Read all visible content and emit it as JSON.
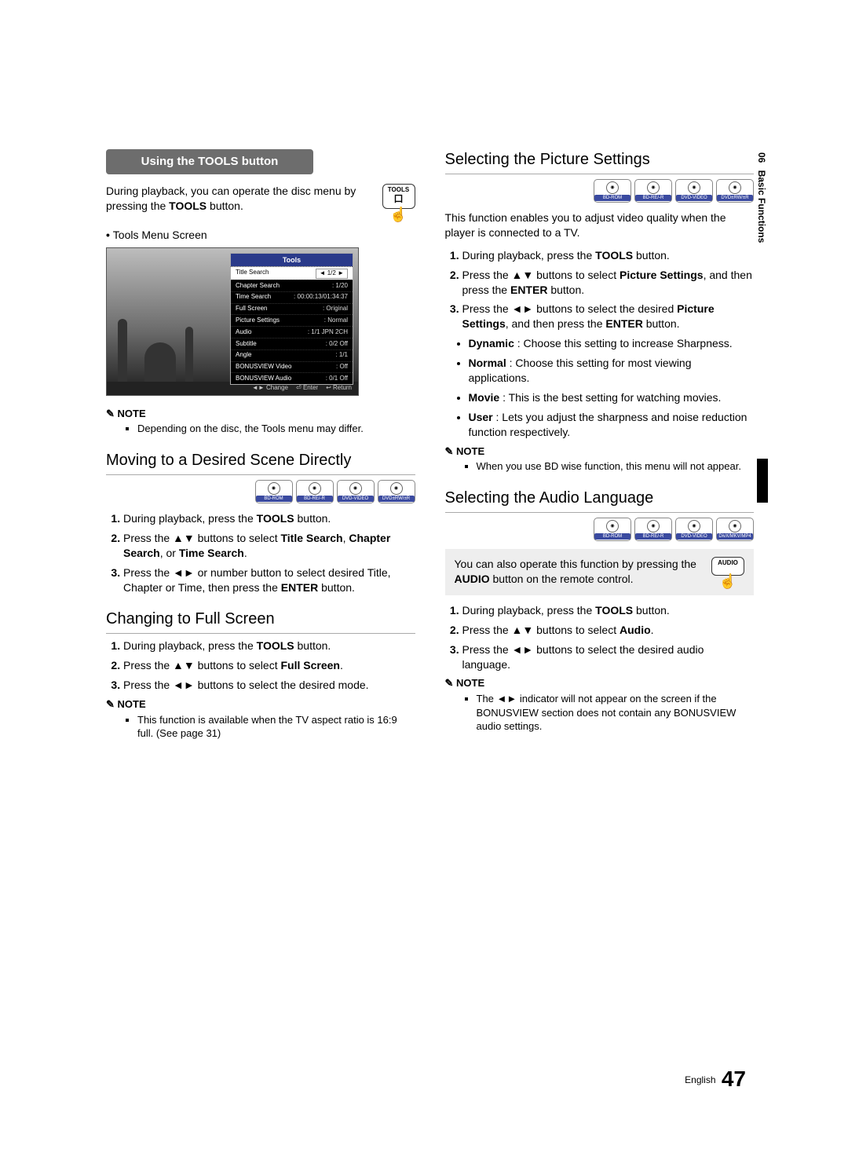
{
  "sideTab": {
    "num": "06",
    "label": "Basic Functions"
  },
  "footer": {
    "lang": "English",
    "page": "47"
  },
  "left": {
    "sectionTab": "Using the TOOLS button",
    "introA": "During playback, you can operate the disc menu by pressing the ",
    "introBold": "TOOLS",
    "introB": " button.",
    "toolsBtn": {
      "label": "TOOLS",
      "sub": "口"
    },
    "toolsMenuLabel": "Tools Menu Screen",
    "toolsPanel": {
      "title": "Tools",
      "rows": [
        {
          "k": "Title Search",
          "v": "1/2",
          "hi": true,
          "arrows": true
        },
        {
          "k": "Chapter Search",
          "v": "1/20"
        },
        {
          "k": "Time Search",
          "v": "00:00:13/01:34:37"
        },
        {
          "k": "Full Screen",
          "v": "Original"
        },
        {
          "k": "Picture Settings",
          "v": "Normal"
        },
        {
          "k": "Audio",
          "v": "1/1 JPN 2CH"
        },
        {
          "k": "Subtitle",
          "v": "0/2 Off"
        },
        {
          "k": "Angle",
          "v": "1/1"
        },
        {
          "k": "BONUSVIEW Video",
          "v": "Off"
        },
        {
          "k": "BONUSVIEW Audio",
          "v": "0/1 Off"
        }
      ],
      "footer": [
        "◄► Change",
        "⏎ Enter",
        "↩ Return"
      ]
    },
    "note1Head": "NOTE",
    "note1Items": [
      "Depending on the disc, the Tools menu may differ."
    ],
    "h2a": "Moving to a Desired Scene Directly",
    "discRowA": [
      "BD-ROM",
      "BD-RE/-R",
      "DVD-VIDEO",
      "DVD±RW/±R"
    ],
    "stepsA": [
      {
        "pre": "During playback, press the ",
        "b": "TOOLS",
        "post": " button."
      },
      {
        "pre": "Press the ▲▼ buttons to select ",
        "b": "Title Search",
        "post2": ", ",
        "b2": "Chapter Search",
        "post3": ", or ",
        "b3": "Time Search",
        "post4": "."
      },
      {
        "pre": "Press the ◄► or number button to select desired Title, Chapter or Time, then press the ",
        "b": "ENTER",
        "post": " button."
      }
    ],
    "h2b": "Changing to Full Screen",
    "stepsB": [
      {
        "pre": "During playback, press the ",
        "b": "TOOLS",
        "post": " button."
      },
      {
        "pre": "Press the ▲▼ buttons to select ",
        "b": "Full Screen",
        "post": "."
      },
      {
        "pre": "Press the ◄► buttons to select the desired mode."
      }
    ],
    "note2Head": "NOTE",
    "note2Items": [
      "This function is available when the TV aspect ratio is 16:9 full. (See page 31)"
    ]
  },
  "right": {
    "h2a": "Selecting the Picture Settings",
    "discRowA": [
      "BD-ROM",
      "BD-RE/-R",
      "DVD-VIDEO",
      "DVD±RW/±R"
    ],
    "introA": "This function enables you to adjust video quality when the player is connected to a TV.",
    "stepsA": [
      {
        "pre": "During playback, press the ",
        "b": "TOOLS",
        "post": " button."
      },
      {
        "pre": "Press the ▲▼ buttons to select ",
        "b": "Picture Settings",
        "post": ", and then press the ",
        "b2": "ENTER",
        "post2": " button."
      },
      {
        "pre": "Press the ◄► buttons to select the desired ",
        "b": "Picture Settings",
        "post": ", and then press the ",
        "b2": "ENTER",
        "post2": " button."
      }
    ],
    "picBullets": [
      {
        "b": "Dynamic",
        "t": " : Choose this setting to increase Sharpness."
      },
      {
        "b": "Normal",
        "t": " : Choose this setting for most viewing applications."
      },
      {
        "b": "Movie",
        "t": " : This is the best setting for watching movies."
      },
      {
        "b": "User",
        "t": " : Lets you adjust the sharpness and noise reduction function respectively."
      }
    ],
    "note1Head": "NOTE",
    "note1Items": [
      "When you use BD wise function, this menu will not appear."
    ],
    "h2b": "Selecting the Audio Language",
    "discRowB": [
      "BD-ROM",
      "BD-RE/-R",
      "DVD-VIDEO",
      "DivX/MKV/MP4"
    ],
    "infoA": "You can also operate this function by pressing the ",
    "infoBold": "AUDIO",
    "infoB": " button on the remote control.",
    "audioBtn": {
      "label": "AUDIO"
    },
    "stepsB": [
      {
        "pre": "During playback, press the ",
        "b": "TOOLS",
        "post": " button."
      },
      {
        "pre": "Press the ▲▼ buttons to select ",
        "b": "Audio",
        "post": "."
      },
      {
        "pre": "Press the ◄► buttons to select the desired audio language."
      }
    ],
    "note2Head": "NOTE",
    "note2Items": [
      "The ◄► indicator will not appear on the screen if the BONUSVIEW section does not contain any BONUSVIEW audio settings."
    ]
  }
}
